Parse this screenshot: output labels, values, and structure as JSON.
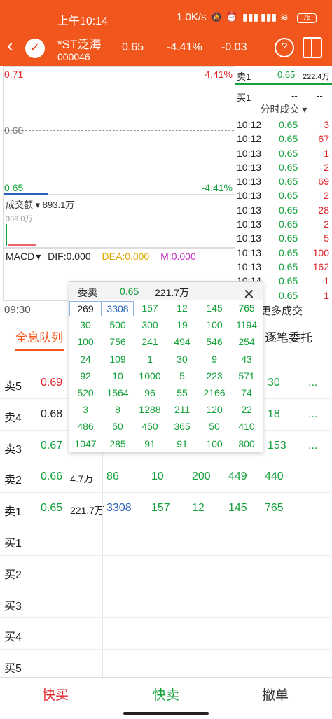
{
  "status": {
    "time": "上午10:14",
    "speed": "1.0K/s",
    "battery": "75"
  },
  "stock": {
    "name": "*ST泛海",
    "code": "000046",
    "price": "0.65",
    "pct": "-4.41%",
    "change": "-0.03"
  },
  "chart": {
    "high": "0.71",
    "high_pct": "4.41%",
    "mid": "0.68",
    "low": "0.65",
    "low_pct": "-4.41%",
    "vol_label": "成交额",
    "vol_value": "893.1万",
    "vol_max": "369.0万",
    "macd_label": "MACD",
    "dif": "DIF:0.000",
    "dea": "DEA:0.000",
    "m": "M:0.000",
    "time_start": "09:30"
  },
  "quote": {
    "sell1_label": "卖1",
    "sell1_price": "0.65",
    "sell1_vol": "222.4万",
    "buy1_label": "买1",
    "buy1_price": "--",
    "buy1_vol": "--"
  },
  "trade_title": "分时成交",
  "trades": [
    {
      "t": "10:12",
      "p": "0.65",
      "v": "3",
      "c": "red"
    },
    {
      "t": "10:12",
      "p": "0.65",
      "v": "67",
      "c": "red"
    },
    {
      "t": "10:13",
      "p": "0.65",
      "v": "1",
      "c": "red"
    },
    {
      "t": "10:13",
      "p": "0.65",
      "v": "2",
      "c": "red"
    },
    {
      "t": "10:13",
      "p": "0.65",
      "v": "69",
      "c": "red"
    },
    {
      "t": "10:13",
      "p": "0.65",
      "v": "2",
      "c": "red"
    },
    {
      "t": "10:13",
      "p": "0.65",
      "v": "28",
      "c": "red"
    },
    {
      "t": "10:13",
      "p": "0.65",
      "v": "2",
      "c": "red"
    },
    {
      "t": "10:13",
      "p": "0.65",
      "v": "5",
      "c": "red"
    },
    {
      "t": "10:13",
      "p": "0.65",
      "v": "100",
      "c": "red"
    },
    {
      "t": "10:13",
      "p": "0.65",
      "v": "162",
      "c": "red"
    },
    {
      "t": "10:14",
      "p": "0.65",
      "v": "1",
      "c": "red"
    },
    {
      "t": "10:14",
      "p": "0.65",
      "v": "1",
      "c": "red"
    }
  ],
  "more_trades": "更多成交",
  "tabs": {
    "queue": "全息队列",
    "orders": "逐笔委托"
  },
  "book": [
    {
      "label": "卖5",
      "price": "0.69",
      "pc": "red",
      "vol": "",
      "right": "30",
      "more": "..."
    },
    {
      "label": "卖4",
      "price": "0.68",
      "pc": "dark",
      "vol": "",
      "right": "18",
      "more": "..."
    },
    {
      "label": "卖3",
      "price": "0.67",
      "pc": "green",
      "vol": "",
      "right": "153",
      "more": "..."
    },
    {
      "label": "卖2",
      "price": "0.66",
      "pc": "green",
      "vol": "4.7万",
      "cells": [
        "86",
        "10",
        "200",
        "449",
        "440"
      ]
    },
    {
      "label": "卖1",
      "price": "0.65",
      "pc": "green",
      "vol": "221.7万",
      "cells": [
        "3308",
        "157",
        "12",
        "145",
        "765"
      ]
    },
    {
      "label": "买1"
    },
    {
      "label": "买2"
    },
    {
      "label": "买3"
    },
    {
      "label": "买4"
    },
    {
      "label": "买5"
    }
  ],
  "popup": {
    "title": "委卖",
    "price": "0.65",
    "vol": "221.7万",
    "rows": [
      [
        "269",
        "3308",
        "157",
        "12",
        "145",
        "765"
      ],
      [
        "30",
        "500",
        "300",
        "19",
        "100",
        "1194"
      ],
      [
        "100",
        "756",
        "241",
        "494",
        "546",
        "254"
      ],
      [
        "24",
        "109",
        "1",
        "30",
        "9",
        "43"
      ],
      [
        "92",
        "10",
        "1000",
        "5",
        "223",
        "571"
      ],
      [
        "520",
        "1564",
        "96",
        "55",
        "2166",
        "74"
      ],
      [
        "3",
        "8",
        "1288",
        "211",
        "120",
        "22"
      ],
      [
        "486",
        "50",
        "450",
        "365",
        "50",
        "410"
      ],
      [
        "1047",
        "285",
        "91",
        "91",
        "100",
        "800"
      ]
    ]
  },
  "bottom": {
    "buy": "快买",
    "sell": "快卖",
    "cancel": "撤单"
  },
  "colors": {
    "brand": "#f1571c",
    "up": "#e0242a",
    "down": "#13a13a"
  }
}
